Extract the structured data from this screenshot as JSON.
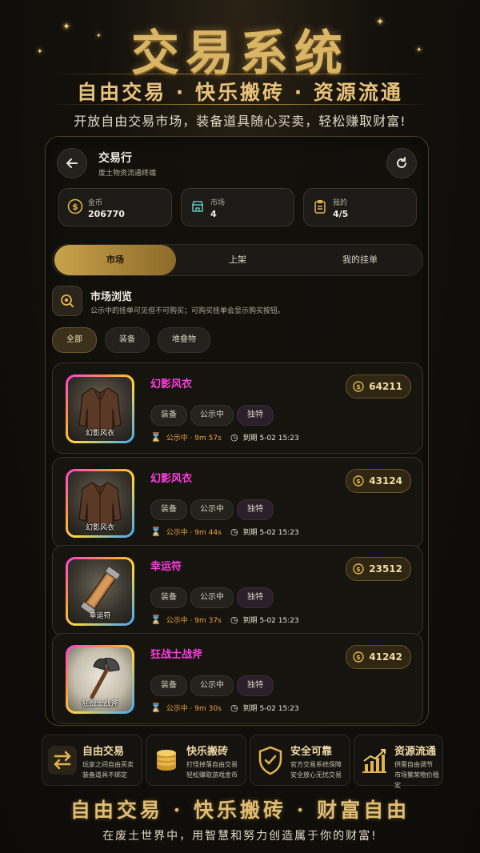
{
  "hero": {
    "title": "交易系统",
    "subtitle": "自由交易 · 快乐搬砖 · 资源流通",
    "description": "开放自由交易市场，装备道具随心买卖，轻松赚取财富!"
  },
  "header": {
    "title": "交易行",
    "subtitle": "废土物资流通终端",
    "back_icon": "arrow-left-icon",
    "refresh_icon": "refresh-icon"
  },
  "stats": [
    {
      "label": "金币",
      "value": "206770",
      "icon": "coin-icon"
    },
    {
      "label": "市场",
      "value": "4",
      "icon": "store-icon"
    },
    {
      "label": "我的",
      "value": "4/5",
      "icon": "clipboard-icon"
    }
  ],
  "tabs": [
    {
      "label": "市场",
      "active": true
    },
    {
      "label": "上架",
      "active": false
    },
    {
      "label": "我的挂单",
      "active": false
    }
  ],
  "browse": {
    "title": "市场浏览",
    "description": "公示中的挂单可见但不可购买；可购买挂单会显示购买按钮。"
  },
  "filters": [
    {
      "label": "全部",
      "active": true
    },
    {
      "label": "装备",
      "active": false
    },
    {
      "label": "堆叠物",
      "active": false
    }
  ],
  "listings": [
    {
      "name": "幻影风衣",
      "thumb_label": "幻影风衣",
      "price": "64211",
      "tags": [
        "装备",
        "公示中",
        "独特"
      ],
      "timer": "公示中 · 9m 57s",
      "expire": "到期 5-02 15:23",
      "icon": "coat-icon"
    },
    {
      "name": "幻影风衣",
      "thumb_label": "幻影风衣",
      "price": "43124",
      "tags": [
        "装备",
        "公示中",
        "独特"
      ],
      "timer": "公示中 · 9m 44s",
      "expire": "到期 5-02 15:23",
      "icon": "coat-icon"
    },
    {
      "name": "幸运符",
      "thumb_label": "幸运符",
      "price": "23512",
      "tags": [
        "装备",
        "公示中",
        "独特"
      ],
      "timer": "公示中 · 9m 37s",
      "expire": "到期 5-02 15:23",
      "icon": "charm-icon"
    },
    {
      "name": "狂战士战斧",
      "thumb_label": "狂战士战斧",
      "price": "41242",
      "tags": [
        "装备",
        "公示中",
        "独特"
      ],
      "timer": "公示中 · 9m 30s",
      "expire": "到期 5-02 15:23",
      "icon": "axe-icon"
    }
  ],
  "features": [
    {
      "title": "自由交易",
      "line1": "玩家之间自由买卖",
      "line2": "装备道具不绑定",
      "icon": "swap-icon"
    },
    {
      "title": "快乐搬砖",
      "line1": "打怪掉落自由交易",
      "line2": "轻松赚取游戏金币",
      "icon": "coin-stack-icon"
    },
    {
      "title": "安全可靠",
      "line1": "官方交易系统保障",
      "line2": "安全放心无忧交易",
      "icon": "shield-check-icon"
    },
    {
      "title": "资源流通",
      "line1": "供需自由调节",
      "line2": "市场繁荣物价稳定",
      "icon": "trend-chart-icon"
    }
  ],
  "footer": {
    "title": "自由交易 · 快乐搬砖 · 财富自由",
    "description": "在废土世界中，用智慧和努力创造属于你的财富!"
  },
  "colors": {
    "accent": "#d9b565",
    "item_name": "#ff3de0",
    "timer": "#e8a23c"
  }
}
